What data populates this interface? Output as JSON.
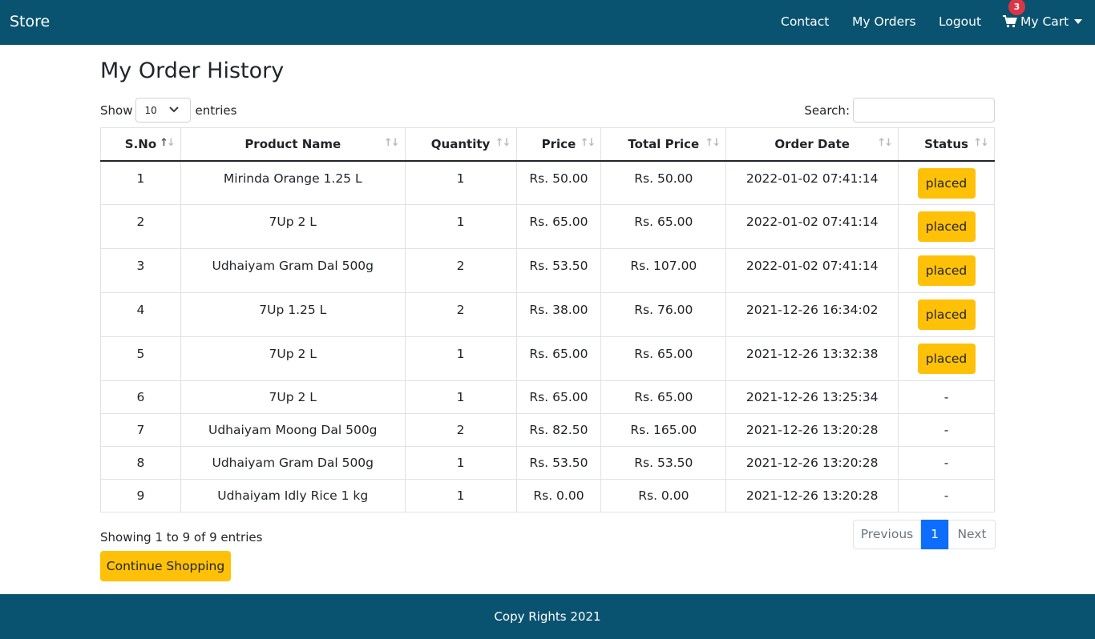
{
  "navbar": {
    "brand": "Store",
    "links": [
      "Contact",
      "My Orders",
      "Logout"
    ],
    "cart_label": "My Cart",
    "cart_count": "3"
  },
  "page": {
    "title": "My Order History",
    "show_prefix": "Show",
    "show_value": "10",
    "show_suffix": "entries",
    "search_label": "Search:",
    "search_value": ""
  },
  "table": {
    "columns": [
      "S.No",
      "Product Name",
      "Quantity",
      "Price",
      "Total Price",
      "Order Date",
      "Status"
    ],
    "rows": [
      {
        "sno": "1",
        "product": "Mirinda Orange 1.25 L",
        "qty": "1",
        "price": "Rs. 50.00",
        "total": "Rs. 50.00",
        "date": "2022-01-02 07:41:14",
        "status": "placed"
      },
      {
        "sno": "2",
        "product": "7Up 2 L",
        "qty": "1",
        "price": "Rs. 65.00",
        "total": "Rs. 65.00",
        "date": "2022-01-02 07:41:14",
        "status": "placed"
      },
      {
        "sno": "3",
        "product": "Udhaiyam Gram Dal 500g",
        "qty": "2",
        "price": "Rs. 53.50",
        "total": "Rs. 107.00",
        "date": "2022-01-02 07:41:14",
        "status": "placed"
      },
      {
        "sno": "4",
        "product": "7Up 1.25 L",
        "qty": "2",
        "price": "Rs. 38.00",
        "total": "Rs. 76.00",
        "date": "2021-12-26 16:34:02",
        "status": "placed"
      },
      {
        "sno": "5",
        "product": "7Up 2 L",
        "qty": "1",
        "price": "Rs. 65.00",
        "total": "Rs. 65.00",
        "date": "2021-12-26 13:32:38",
        "status": "placed"
      },
      {
        "sno": "6",
        "product": "7Up 2 L",
        "qty": "1",
        "price": "Rs. 65.00",
        "total": "Rs. 65.00",
        "date": "2021-12-26 13:25:34",
        "status": "-"
      },
      {
        "sno": "7",
        "product": "Udhaiyam Moong Dal 500g",
        "qty": "2",
        "price": "Rs. 82.50",
        "total": "Rs. 165.00",
        "date": "2021-12-26 13:20:28",
        "status": "-"
      },
      {
        "sno": "8",
        "product": "Udhaiyam Gram Dal 500g",
        "qty": "1",
        "price": "Rs. 53.50",
        "total": "Rs. 53.50",
        "date": "2021-12-26 13:20:28",
        "status": "-"
      },
      {
        "sno": "9",
        "product": "Udhaiyam Idly Rice 1 kg",
        "qty": "1",
        "price": "Rs. 0.00",
        "total": "Rs. 0.00",
        "date": "2021-12-26 13:20:28",
        "status": "-"
      }
    ]
  },
  "footer_table": {
    "info": "Showing 1 to 9 of 9 entries",
    "pagination": {
      "previous": "Previous",
      "current": "1",
      "next": "Next"
    },
    "continue_label": "Continue Shopping"
  },
  "footer": {
    "text": "Copy Rights 2021"
  },
  "colors": {
    "navbar": "#0a5370",
    "accent": "#ffc107",
    "primary": "#0d6efd",
    "badge": "#dc3545"
  }
}
